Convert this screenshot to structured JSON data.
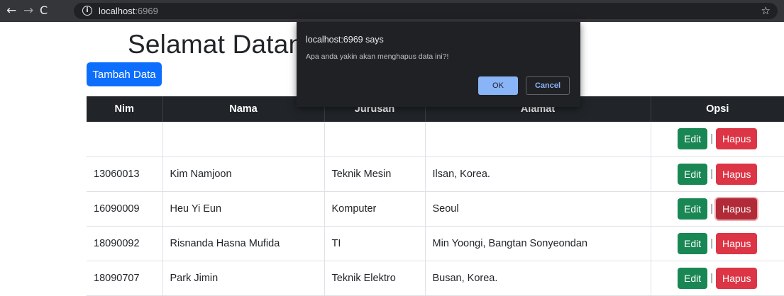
{
  "browser": {
    "host": "localhost",
    "port": ":6969",
    "back_icon": "←",
    "forward_icon": "→",
    "reload_icon": "C",
    "info_icon": "i",
    "star_icon": "☆"
  },
  "page": {
    "title": "Selamat Datang di Data Mahasiswa",
    "add_button": "Tambah Data"
  },
  "table": {
    "headers": [
      "Nim",
      "Nama",
      "Jurusan",
      "Alamat",
      "Opsi"
    ],
    "rows": [
      {
        "nim": "",
        "nama": "",
        "jurusan": "",
        "alamat": ""
      },
      {
        "nim": "13060013",
        "nama": "Kim Namjoon",
        "jurusan": "Teknik Mesin",
        "alamat": "Ilsan, Korea."
      },
      {
        "nim": "16090009",
        "nama": "Heu Yi Eun",
        "jurusan": "Komputer",
        "alamat": "Seoul"
      },
      {
        "nim": "18090092",
        "nama": "Risnanda Hasna Mufida",
        "jurusan": "TI",
        "alamat": "Min Yoongi, Bangtan Sonyeondan"
      },
      {
        "nim": "18090707",
        "nama": "Park Jimin",
        "jurusan": "Teknik Elektro",
        "alamat": "Busan, Korea."
      }
    ],
    "edit_label": "Edit",
    "separator": "|",
    "delete_label": "Hapus"
  },
  "dialog": {
    "title": "localhost:6969 says",
    "message": "Apa anda yakin akan menghapus data ini?!",
    "ok_label": "OK",
    "cancel_label": "Cancel"
  },
  "colors": {
    "primary": "#0d6efd",
    "success": "#198754",
    "danger": "#dc3545",
    "header_dark": "#212529"
  }
}
